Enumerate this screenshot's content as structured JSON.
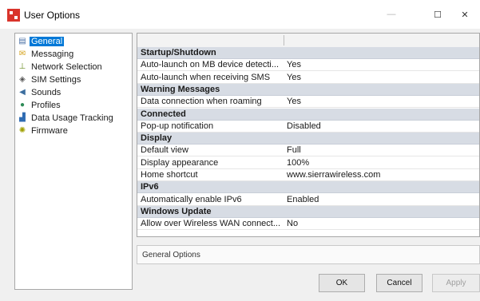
{
  "window": {
    "title": "User Options",
    "controls": {
      "minimize": "—",
      "maximize": "☐",
      "close": "✕"
    }
  },
  "tree": {
    "items": [
      {
        "label": "General",
        "icon": "page-icon",
        "selected": true
      },
      {
        "label": "Messaging",
        "icon": "envelope-icon"
      },
      {
        "label": "Network Selection",
        "icon": "antenna-icon"
      },
      {
        "label": "SIM Settings",
        "icon": "sim-icon"
      },
      {
        "label": "Sounds",
        "icon": "speaker-icon"
      },
      {
        "label": "Profiles",
        "icon": "profile-icon"
      },
      {
        "label": "Data Usage Tracking",
        "icon": "chart-icon"
      },
      {
        "label": "Firmware",
        "icon": "firmware-icon"
      }
    ]
  },
  "grid": {
    "rows": [
      {
        "type": "section",
        "name": "Startup/Shutdown"
      },
      {
        "type": "item",
        "name": "Auto-launch on MB device detecti...",
        "value": "Yes"
      },
      {
        "type": "item",
        "name": "Auto-launch when receiving SMS",
        "value": "Yes"
      },
      {
        "type": "section",
        "name": "Warning Messages"
      },
      {
        "type": "item",
        "name": "Data connection when roaming",
        "value": "Yes"
      },
      {
        "type": "section",
        "name": "Connected"
      },
      {
        "type": "item",
        "name": "Pop-up notification",
        "value": "Disabled"
      },
      {
        "type": "section",
        "name": "Display"
      },
      {
        "type": "item",
        "name": "Default view",
        "value": "Full"
      },
      {
        "type": "item",
        "name": "Display appearance",
        "value": "100%"
      },
      {
        "type": "item",
        "name": "Home shortcut",
        "value": "www.sierrawireless.com"
      },
      {
        "type": "section",
        "name": "IPv6"
      },
      {
        "type": "item",
        "name": "Automatically enable IPv6",
        "value": "Enabled"
      },
      {
        "type": "section",
        "name": "Windows Update"
      },
      {
        "type": "item",
        "name": "Allow over Wireless WAN connect...",
        "value": "No"
      }
    ]
  },
  "description": "General Options",
  "buttons": {
    "ok": "OK",
    "cancel": "Cancel",
    "apply": "Apply"
  },
  "colors": {
    "selection": "#0078d7",
    "section_row": "#d7dce4",
    "app_icon": "#d9342b"
  }
}
